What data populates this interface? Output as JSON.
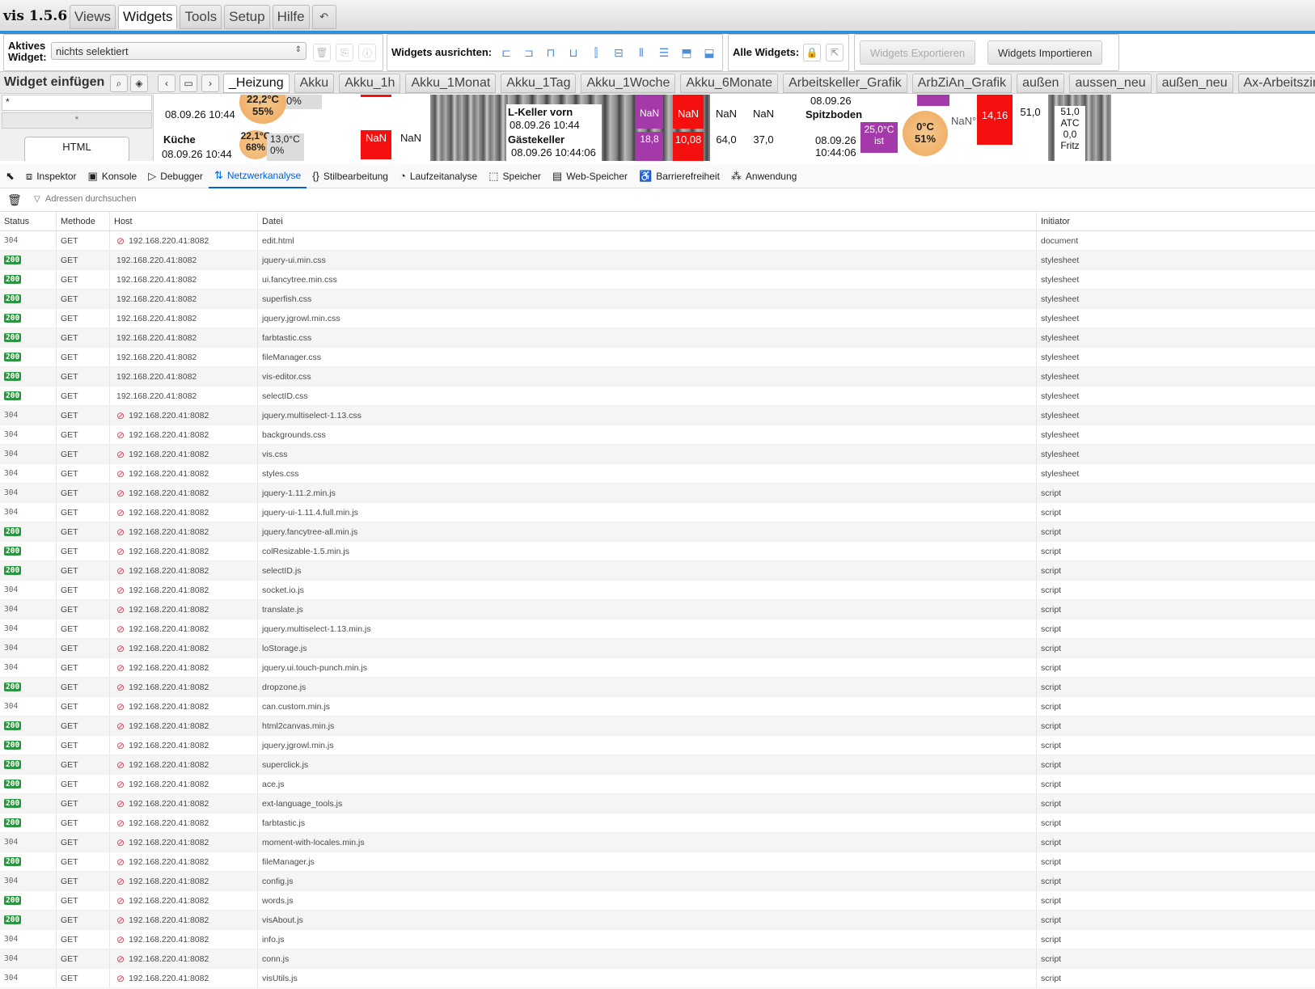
{
  "app": {
    "title": "vis 1.5.6",
    "menu_tabs": [
      "Views",
      "Widgets",
      "Tools",
      "Setup",
      "Hilfe"
    ],
    "undo_label": "↶"
  },
  "toolbar": {
    "active_widget_label_1": "Aktives",
    "active_widget_label_2": "Widget:",
    "active_widget_value": "nichts selektiert",
    "align_label": "Widgets ausrichten:",
    "all_widgets_label": "Alle Widgets:",
    "export_label": "Widgets Exportieren",
    "import_label": "Widgets Importieren"
  },
  "views": {
    "insert_label": "Widget einfügen",
    "tabs": [
      "_Heizung",
      "Akku",
      "Akku_1h",
      "Akku_1Monat",
      "Akku_1Tag",
      "Akku_1Woche",
      "Akku_6Monate",
      "Arbeitskeller_Grafik",
      "ArbZiAn_Grafik",
      "außen",
      "aussen_neu",
      "außen_neu",
      "Ax-Arbeitszimm"
    ]
  },
  "palette": {
    "filter_value": "*",
    "filter2_value": "*",
    "html_widget": "HTML"
  },
  "preview": {
    "t1": "08.09.26 10:44",
    "t2": "Küche",
    "t3": "08.09.26 10:44",
    "t4": "22,1°C",
    "t5": "68%",
    "t6": "13,0°C",
    "t7": "0%",
    "t8": "22,2°C",
    "t9": "55%",
    "t10": "0%",
    "n1": "NaN",
    "n2": "NaN",
    "k1": "L-Keller vorn",
    "k2": "08.09.26 10:44",
    "k3": "Gästekeller",
    "k4": "08.09.26 10:44:06",
    "v1": "NaN",
    "v2": "NaN",
    "v3": "NaN",
    "v4": "NaN",
    "v5": "18,8",
    "v6": "10,08",
    "v7": "64,0",
    "v8": "37,0",
    "s1": "08.09.26",
    "s2": "Spitzboden",
    "s3": "08.09.26",
    "s4": "10:44:06",
    "s5": "25,0°C",
    "s6": "ist",
    "s7": "0°C",
    "s8": "51%",
    "s9": "NaN°",
    "r1": "14,16",
    "r2": "51,0",
    "r3": "51,0",
    "r4": "ATC",
    "r5": "0,0",
    "r6": "Fritz"
  },
  "devtools": {
    "tabs": [
      {
        "icon": "⧈",
        "label": "Inspektor"
      },
      {
        "icon": "▣",
        "label": "Konsole"
      },
      {
        "icon": "▷",
        "label": "Debugger"
      },
      {
        "icon": "⇅",
        "label": "Netzwerkanalyse"
      },
      {
        "icon": "{}",
        "label": "Stilbearbeitung"
      },
      {
        "icon": "◔",
        "label": "Laufzeitanalyse"
      },
      {
        "icon": "⬚",
        "label": "Speicher"
      },
      {
        "icon": "▤",
        "label": "Web-Speicher"
      },
      {
        "icon": "♿",
        "label": "Barrierefreiheit"
      },
      {
        "icon": "⁂",
        "label": "Anwendung"
      }
    ],
    "filter_placeholder": "Adressen durchsuchen",
    "columns": [
      "Status",
      "Methode",
      "Host",
      "Datei",
      "Initiator"
    ],
    "rows": [
      [
        "304",
        "GET",
        "192.168.220.41:8082",
        "edit.html",
        "document",
        true
      ],
      [
        "200",
        "GET",
        "192.168.220.41:8082",
        "jquery-ui.min.css",
        "stylesheet",
        false
      ],
      [
        "200",
        "GET",
        "192.168.220.41:8082",
        "ui.fancytree.min.css",
        "stylesheet",
        false
      ],
      [
        "200",
        "GET",
        "192.168.220.41:8082",
        "superfish.css",
        "stylesheet",
        false
      ],
      [
        "200",
        "GET",
        "192.168.220.41:8082",
        "jquery.jgrowl.min.css",
        "stylesheet",
        false
      ],
      [
        "200",
        "GET",
        "192.168.220.41:8082",
        "farbtastic.css",
        "stylesheet",
        false
      ],
      [
        "200",
        "GET",
        "192.168.220.41:8082",
        "fileManager.css",
        "stylesheet",
        false
      ],
      [
        "200",
        "GET",
        "192.168.220.41:8082",
        "vis-editor.css",
        "stylesheet",
        false
      ],
      [
        "200",
        "GET",
        "192.168.220.41:8082",
        "selectID.css",
        "stylesheet",
        false
      ],
      [
        "304",
        "GET",
        "192.168.220.41:8082",
        "jquery.multiselect-1.13.css",
        "stylesheet",
        true
      ],
      [
        "304",
        "GET",
        "192.168.220.41:8082",
        "backgrounds.css",
        "stylesheet",
        true
      ],
      [
        "304",
        "GET",
        "192.168.220.41:8082",
        "vis.css",
        "stylesheet",
        true
      ],
      [
        "304",
        "GET",
        "192.168.220.41:8082",
        "styles.css",
        "stylesheet",
        true
      ],
      [
        "304",
        "GET",
        "192.168.220.41:8082",
        "jquery-1.11.2.min.js",
        "script",
        true
      ],
      [
        "304",
        "GET",
        "192.168.220.41:8082",
        "jquery-ui-1.11.4.full.min.js",
        "script",
        true
      ],
      [
        "200",
        "GET",
        "192.168.220.41:8082",
        "jquery.fancytree-all.min.js",
        "script",
        true
      ],
      [
        "200",
        "GET",
        "192.168.220.41:8082",
        "colResizable-1.5.min.js",
        "script",
        true
      ],
      [
        "200",
        "GET",
        "192.168.220.41:8082",
        "selectID.js",
        "script",
        true
      ],
      [
        "304",
        "GET",
        "192.168.220.41:8082",
        "socket.io.js",
        "script",
        true
      ],
      [
        "304",
        "GET",
        "192.168.220.41:8082",
        "translate.js",
        "script",
        true
      ],
      [
        "304",
        "GET",
        "192.168.220.41:8082",
        "jquery.multiselect-1.13.min.js",
        "script",
        true
      ],
      [
        "304",
        "GET",
        "192.168.220.41:8082",
        "loStorage.js",
        "script",
        true
      ],
      [
        "304",
        "GET",
        "192.168.220.41:8082",
        "jquery.ui.touch-punch.min.js",
        "script",
        true
      ],
      [
        "200",
        "GET",
        "192.168.220.41:8082",
        "dropzone.js",
        "script",
        true
      ],
      [
        "304",
        "GET",
        "192.168.220.41:8082",
        "can.custom.min.js",
        "script",
        true
      ],
      [
        "200",
        "GET",
        "192.168.220.41:8082",
        "html2canvas.min.js",
        "script",
        true
      ],
      [
        "200",
        "GET",
        "192.168.220.41:8082",
        "jquery.jgrowl.min.js",
        "script",
        true
      ],
      [
        "200",
        "GET",
        "192.168.220.41:8082",
        "superclick.js",
        "script",
        true
      ],
      [
        "200",
        "GET",
        "192.168.220.41:8082",
        "ace.js",
        "script",
        true
      ],
      [
        "200",
        "GET",
        "192.168.220.41:8082",
        "ext-language_tools.js",
        "script",
        true
      ],
      [
        "200",
        "GET",
        "192.168.220.41:8082",
        "farbtastic.js",
        "script",
        true
      ],
      [
        "304",
        "GET",
        "192.168.220.41:8082",
        "moment-with-locales.min.js",
        "script",
        true
      ],
      [
        "200",
        "GET",
        "192.168.220.41:8082",
        "fileManager.js",
        "script",
        true
      ],
      [
        "304",
        "GET",
        "192.168.220.41:8082",
        "config.js",
        "script",
        true
      ],
      [
        "200",
        "GET",
        "192.168.220.41:8082",
        "words.js",
        "script",
        true
      ],
      [
        "200",
        "GET",
        "192.168.220.41:8082",
        "visAbout.js",
        "script",
        true
      ],
      [
        "304",
        "GET",
        "192.168.220.41:8082",
        "info.js",
        "script",
        true
      ],
      [
        "304",
        "GET",
        "192.168.220.41:8082",
        "conn.js",
        "script",
        true
      ],
      [
        "304",
        "GET",
        "192.168.220.41:8082",
        "visUtils.js",
        "script",
        true
      ]
    ]
  }
}
